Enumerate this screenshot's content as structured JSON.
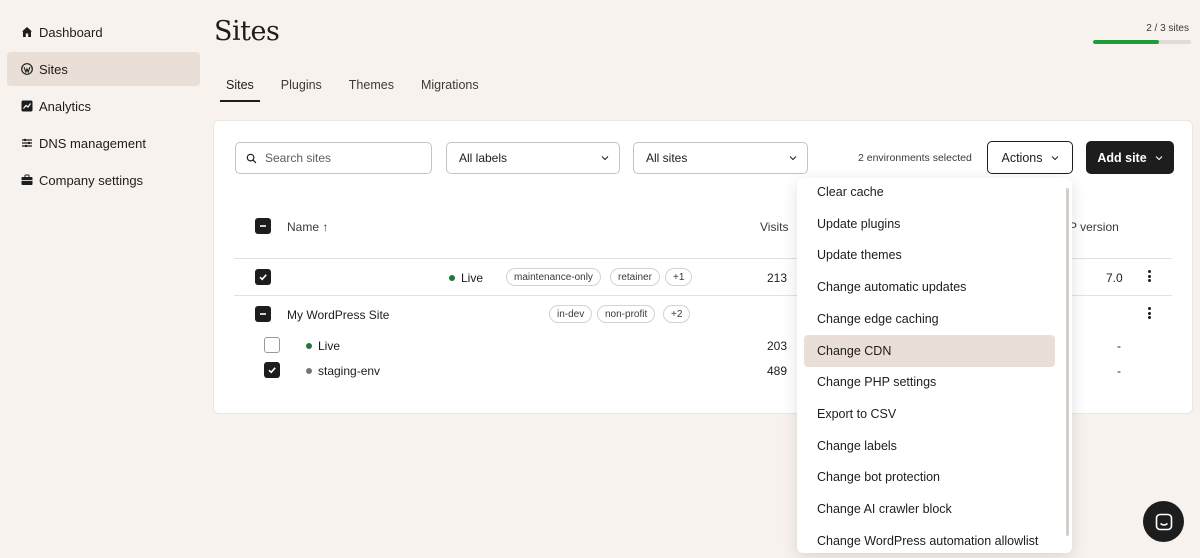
{
  "sidebar": {
    "items": [
      {
        "label": "Dashboard",
        "icon": "home-icon",
        "active": false
      },
      {
        "label": "Sites",
        "icon": "wordpress-icon",
        "active": true
      },
      {
        "label": "Analytics",
        "icon": "analytics-icon",
        "active": false
      },
      {
        "label": "DNS management",
        "icon": "dns-icon",
        "active": false
      },
      {
        "label": "Company settings",
        "icon": "briefcase-icon",
        "active": false
      }
    ]
  },
  "header": {
    "title": "Sites",
    "quota_text": "2 / 3 sites",
    "quota_fraction": 0.67,
    "quota_color": "#1e9c3c"
  },
  "tabs": [
    {
      "label": "Sites",
      "active": true
    },
    {
      "label": "Plugins",
      "active": false
    },
    {
      "label": "Themes",
      "active": false
    },
    {
      "label": "Migrations",
      "active": false
    }
  ],
  "toolbar": {
    "search_placeholder": "Search sites",
    "labels_select": "All labels",
    "sites_select": "All sites",
    "selection_text": "2 environments selected",
    "actions_label": "Actions",
    "add_site_label": "Add site"
  },
  "table": {
    "headers": {
      "name": "Name ↑",
      "visits": "Visits",
      "php": "P version"
    },
    "rows": [
      {
        "name": "",
        "status": "Live",
        "tags": [
          "maintenance-only",
          "retainer",
          "+1"
        ],
        "visits": "213",
        "php": "7.0"
      },
      {
        "name": "My WordPress Site",
        "tags": [
          "in-dev",
          "non-profit",
          "+2"
        ],
        "environments": [
          {
            "name": "Live",
            "visits": "203",
            "php": "-"
          },
          {
            "name": "staging-env",
            "visits": "489",
            "php": "-"
          }
        ]
      }
    ]
  },
  "actions_menu": {
    "items": [
      "Clear cache",
      "Update plugins",
      "Update themes",
      "Change automatic updates",
      "Change edge caching",
      "Change CDN",
      "Change PHP settings",
      "Export to CSV",
      "Change labels",
      "Change bot protection",
      "Change AI crawler block",
      "Change WordPress automation allowlist"
    ],
    "highlighted": "Change CDN"
  },
  "colors": {
    "background": "#f7f2ee",
    "active_bg": "#e9dfd6",
    "primary": "#1d1d1d",
    "live_dot": "#1e7a35"
  }
}
